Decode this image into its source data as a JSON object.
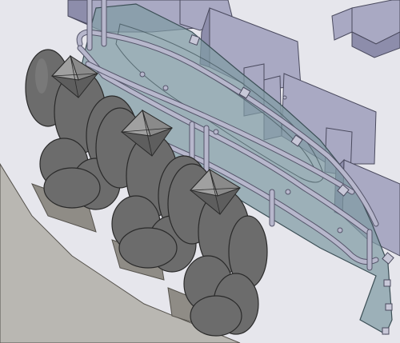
{
  "scene": {
    "kind": "cad-assembly-isometric",
    "background": "#e6e6ec",
    "colors": {
      "seat": "#a9a9c3",
      "seat_side": "#8d8dab",
      "seat_edge": "#4a4a5e",
      "panel": "#7f9ba4",
      "panel_edge": "#3c4f56",
      "rail": "#b7b7cc",
      "rail_edge": "#55556a",
      "cushion": "#6c6c6c",
      "cushion_light": "#858585",
      "cushion_edge": "#2a2a2a",
      "cap": "#8a8a8a",
      "floor_slab": "#b9b7b2",
      "bracket": "#c8c8d8"
    },
    "parts": [
      {
        "name": "seat-row",
        "count": 4
      },
      {
        "name": "glass-panel",
        "count": 1
      },
      {
        "name": "tube-railing",
        "count": 1
      },
      {
        "name": "bolster-cushion-stack",
        "count": 3
      },
      {
        "name": "pyramid-cap",
        "count": 3
      },
      {
        "name": "mount-bracket",
        "count": 8
      }
    ]
  }
}
